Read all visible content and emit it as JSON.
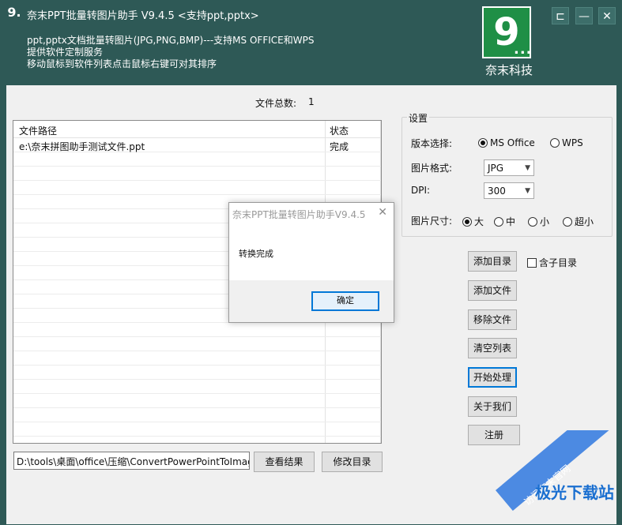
{
  "header": {
    "logo_glyph": "9.",
    "title": "奈末PPT批量转图片助手   V9.4.5   <支持ppt,pptx>",
    "line1": "ppt,pptx文档批量转图片(JPG,PNG,BMP)---支持MS OFFICE和WPS",
    "line2": "提供软件定制服务",
    "line3": "移动鼠标到软件列表点击鼠标右键可对其排序",
    "brand_glyph": "9",
    "brand_dots": "...",
    "brand_name": "奈末科技",
    "btn_pin": "⊏",
    "btn_min": "—",
    "btn_close": "✕"
  },
  "file_count": {
    "label": "文件总数:",
    "value": "1"
  },
  "file_list": {
    "columns": [
      "文件路径",
      "状态"
    ],
    "rows": [
      {
        "path": "e:\\奈末拼图助手测试文件.ppt",
        "status": "完成"
      }
    ]
  },
  "settings": {
    "title": "设置",
    "version_label": "版本选择:",
    "version_options": [
      "MS Office",
      "WPS"
    ],
    "version_selected": "MS Office",
    "format_label": "图片格式:",
    "format_value": "JPG",
    "dpi_label": "DPI:",
    "dpi_value": "300",
    "size_label": "图片尺寸:",
    "size_options": [
      "大",
      "中",
      "小",
      "超小"
    ],
    "size_selected": "大"
  },
  "buttons": {
    "add_dir": "添加目录",
    "include_subdir": "含子目录",
    "add_file": "添加文件",
    "remove_file": "移除文件",
    "clear_list": "清空列表",
    "start": "开始处理",
    "about": "关于我们",
    "register": "注册",
    "view_result": "查看结果",
    "change_dir": "修改目录"
  },
  "output_path": "D:\\tools\\桌面\\office\\压缩\\ConvertPowerPointToImage",
  "dialog": {
    "title": "奈末PPT批量转图片助手V9.4.5",
    "close": "✕",
    "message": "转换完成",
    "ok": "确定"
  },
  "watermark": {
    "band_text": "访问奈末官网",
    "logo_text": "极光下载站"
  }
}
